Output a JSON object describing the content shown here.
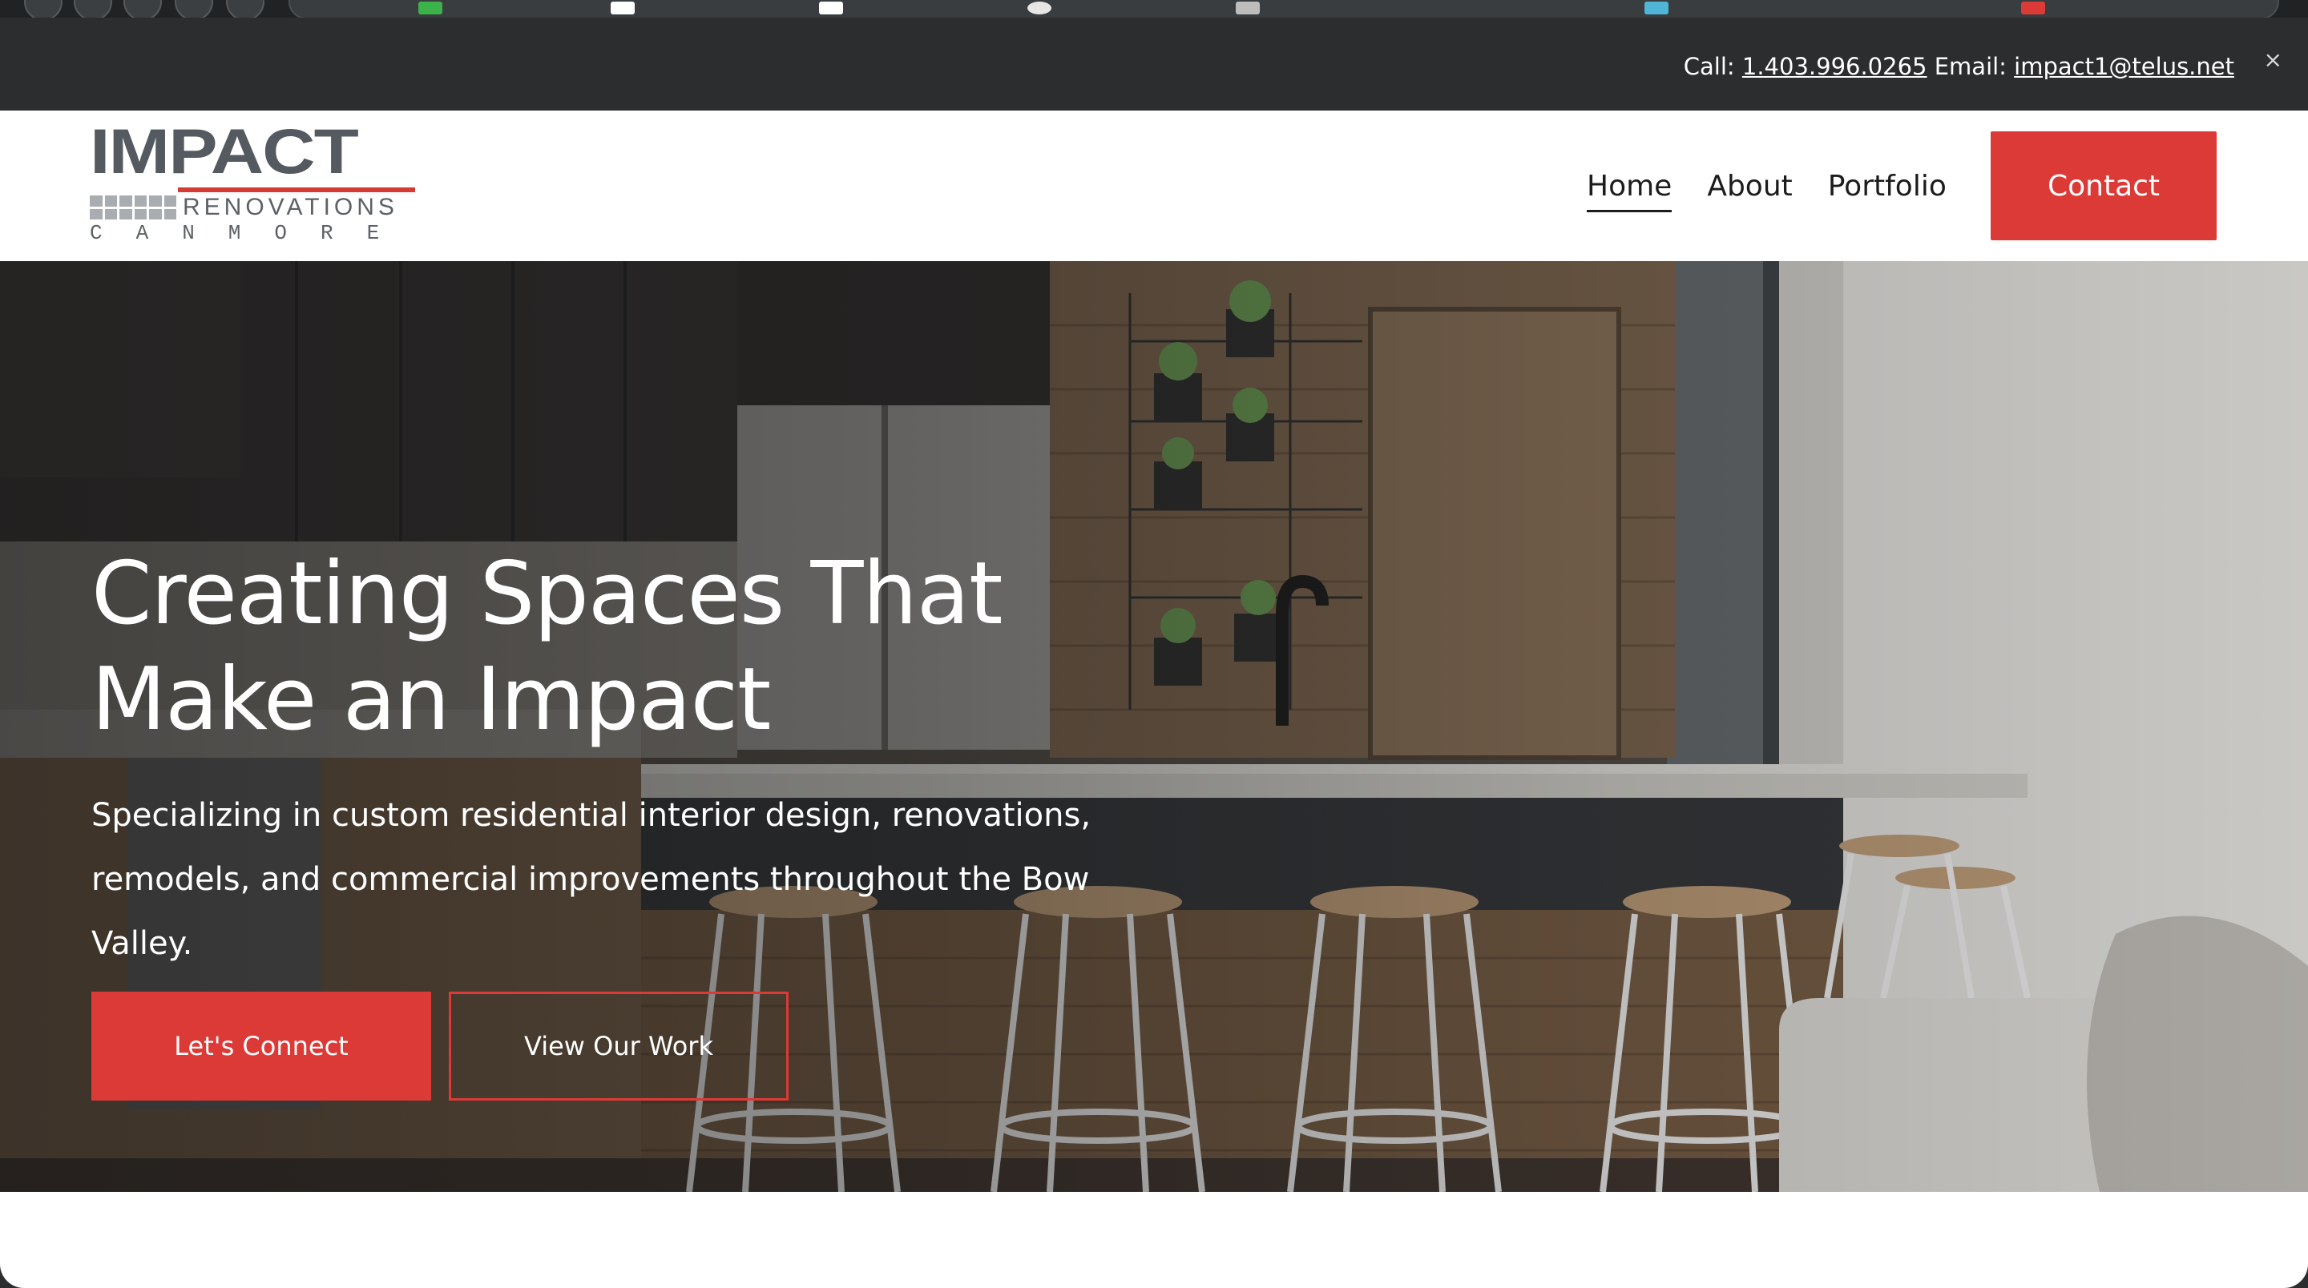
{
  "top_bar": {
    "call_label": "Call:",
    "phone": "1.403.996.0265",
    "email_label": "Email:",
    "email": "impact1@telus.net",
    "close_glyph": "×"
  },
  "logo": {
    "word": "IMPACT",
    "sub": "RENOVATIONS",
    "city": "CANMORE"
  },
  "nav": {
    "items": [
      {
        "label": "Home",
        "active": true
      },
      {
        "label": "About",
        "active": false
      },
      {
        "label": "Portfolio",
        "active": false
      }
    ],
    "contact_label": "Contact"
  },
  "hero": {
    "title": "Creating Spaces That Make an Impact",
    "subtitle": "Specializing in custom residential interior design, renovations, remodels, and commercial improvements throughout the Bow Valley.",
    "primary_cta": "Let's Connect",
    "secondary_cta": "View Our Work"
  },
  "colors": {
    "accent": "#dc3a36",
    "dark_bar": "#2b2d2e",
    "logo_gray": "#555a60"
  }
}
